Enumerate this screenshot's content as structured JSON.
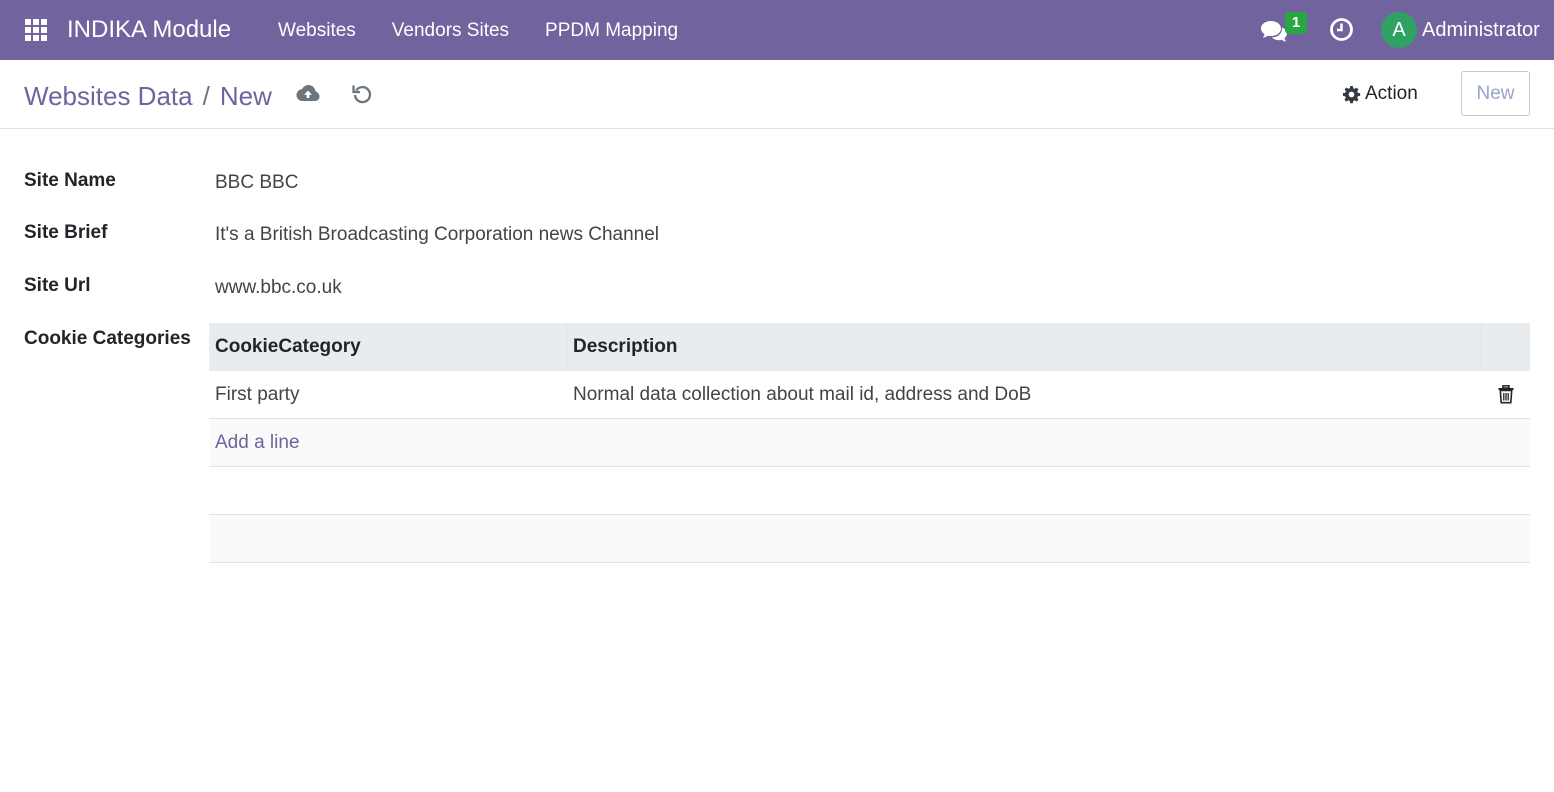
{
  "navbar": {
    "brand": "INDIKA Module",
    "menu": [
      "Websites",
      "Vendors Sites",
      "PPDM Mapping"
    ],
    "chat_count": "1",
    "avatar_initial": "A",
    "user_name": "Administrator",
    "bg_color": "#71639e"
  },
  "control_panel": {
    "breadcrumb_parent": "Websites Data",
    "breadcrumb_separator": "/",
    "breadcrumb_current": "New",
    "action_label": "Action",
    "new_label": "New"
  },
  "form": {
    "site_name_label": "Site Name",
    "site_name_value": "BBC BBC",
    "site_brief_label": "Site Brief",
    "site_brief_value": "It's a British Broadcasting Corporation news Channel",
    "site_url_label": "Site Url",
    "site_url_value": "www.bbc.co.uk",
    "cookie_categories_label": "Cookie Categories"
  },
  "table": {
    "headers": [
      "CookieCategory",
      "Description"
    ],
    "rows": [
      {
        "category": "First party",
        "description": "Normal data collection about mail id, address and DoB"
      }
    ],
    "add_line": "Add a line"
  }
}
